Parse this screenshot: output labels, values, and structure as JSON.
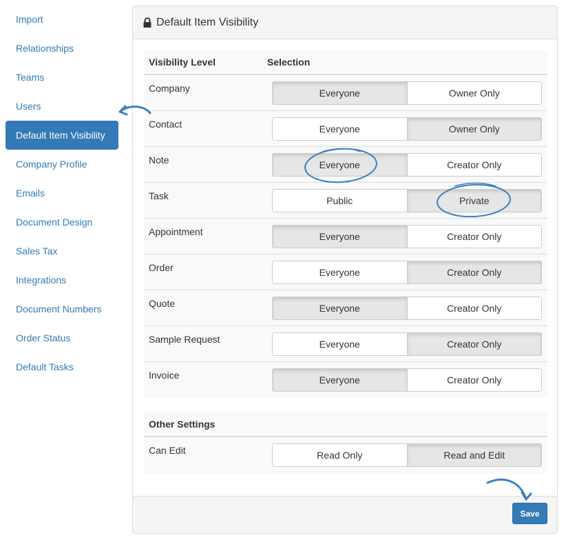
{
  "sidebar": {
    "items": [
      {
        "label": "Import"
      },
      {
        "label": "Relationships"
      },
      {
        "label": "Teams"
      },
      {
        "label": "Users"
      },
      {
        "label": "Default Item Visibility",
        "active": true
      },
      {
        "label": "Company Profile"
      },
      {
        "label": "Emails"
      },
      {
        "label": "Document Design"
      },
      {
        "label": "Sales Tax"
      },
      {
        "label": "Integrations"
      },
      {
        "label": "Document Numbers"
      },
      {
        "label": "Order Status"
      },
      {
        "label": "Default Tasks"
      }
    ]
  },
  "panel": {
    "title": "Default Item Visibility",
    "icon": "lock-icon"
  },
  "visibility_table": {
    "headers": {
      "level": "Visibility Level",
      "selection": "Selection"
    },
    "rows": [
      {
        "label": "Company",
        "options": [
          "Everyone",
          "Owner Only"
        ],
        "selected": 0
      },
      {
        "label": "Contact",
        "options": [
          "Everyone",
          "Owner Only"
        ],
        "selected": 1
      },
      {
        "label": "Note",
        "options": [
          "Everyone",
          "Creator Only"
        ],
        "selected": 0
      },
      {
        "label": "Task",
        "options": [
          "Public",
          "Private"
        ],
        "selected": 1
      },
      {
        "label": "Appointment",
        "options": [
          "Everyone",
          "Creator Only"
        ],
        "selected": 0
      },
      {
        "label": "Order",
        "options": [
          "Everyone",
          "Creator Only"
        ],
        "selected": 1
      },
      {
        "label": "Quote",
        "options": [
          "Everyone",
          "Creator Only"
        ],
        "selected": 0
      },
      {
        "label": "Sample Request",
        "options": [
          "Everyone",
          "Creator Only"
        ],
        "selected": 1
      },
      {
        "label": "Invoice",
        "options": [
          "Everyone",
          "Creator Only"
        ],
        "selected": 0
      }
    ]
  },
  "other_settings": {
    "header": "Other Settings",
    "rows": [
      {
        "label": "Can Edit",
        "options": [
          "Read Only",
          "Read and Edit"
        ],
        "selected": 1
      }
    ]
  },
  "footer": {
    "save_label": "Save"
  },
  "colors": {
    "accent": "#337ab7",
    "annotation": "#3a7fc1"
  }
}
